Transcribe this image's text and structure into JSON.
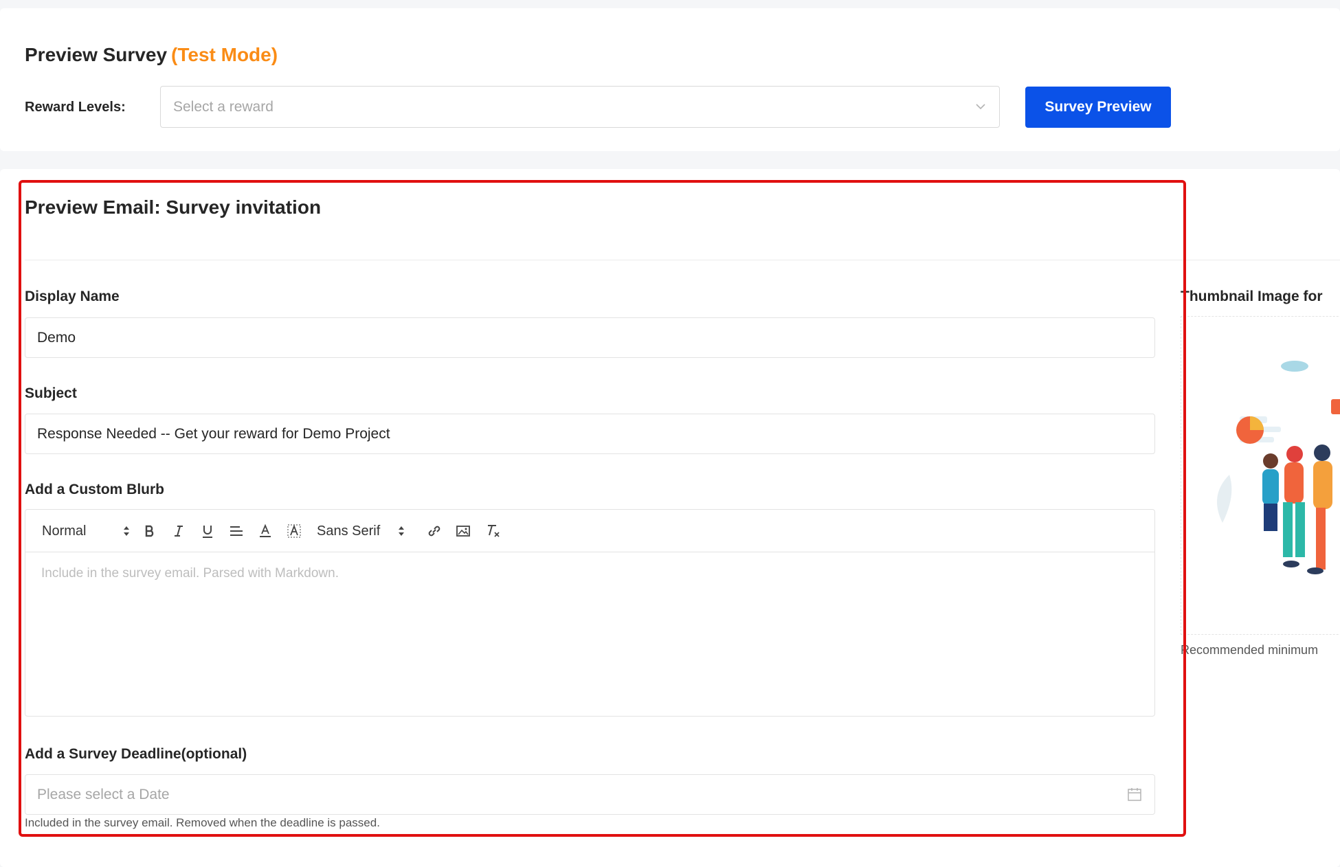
{
  "header": {
    "title": "Preview Survey",
    "mode": "(Test Mode)",
    "reward_label": "Reward Levels:",
    "reward_placeholder": "Select a reward",
    "survey_preview_button": "Survey Preview"
  },
  "email": {
    "title": "Preview Email: Survey invitation",
    "display_name_label": "Display Name",
    "display_name_value": "Demo",
    "subject_label": "Subject",
    "subject_value": "Response Needed -- Get your reward for Demo Project",
    "blurb_label": "Add a Custom Blurb",
    "blurb_placeholder": "Include in the survey email. Parsed with Markdown.",
    "toolbar": {
      "heading_select": "Normal",
      "font_select": "Sans Serif",
      "icons": [
        "bold-icon",
        "italic-icon",
        "underline-icon",
        "align-icon",
        "text-color-icon",
        "background-color-icon",
        "link-icon",
        "image-icon",
        "clear-format-icon"
      ]
    },
    "deadline_label": "Add a Survey Deadline(optional)",
    "deadline_placeholder": "Please select a Date",
    "deadline_help": "Included in the survey email. Removed when the deadline is passed."
  },
  "thumbnail": {
    "label": "Thumbnail Image for",
    "note": "Recommended minimum"
  },
  "colors": {
    "accent": "#0b52e8",
    "test_mode": "#fa8c16",
    "highlight": "#e01010"
  }
}
